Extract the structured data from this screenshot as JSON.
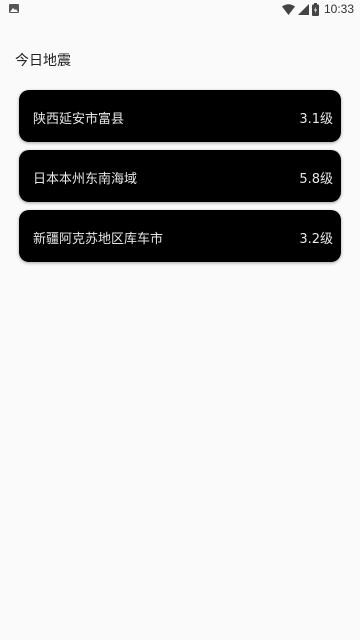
{
  "status_bar": {
    "time": "10:33",
    "left_icon": "image-icon",
    "icons": [
      "wifi-icon",
      "signal-icon",
      "battery-icon"
    ]
  },
  "page": {
    "title": "今日地震"
  },
  "quakes": [
    {
      "location": "陕西延安市富县",
      "magnitude": "3.1级"
    },
    {
      "location": "日本本州东南海域",
      "magnitude": "5.8级"
    },
    {
      "location": "新疆阿克苏地区库车市",
      "magnitude": "3.2级"
    }
  ],
  "colors": {
    "background": "#fafafa",
    "card": "#000000",
    "card_text": "#e6e6e6",
    "title_text": "#222222"
  }
}
